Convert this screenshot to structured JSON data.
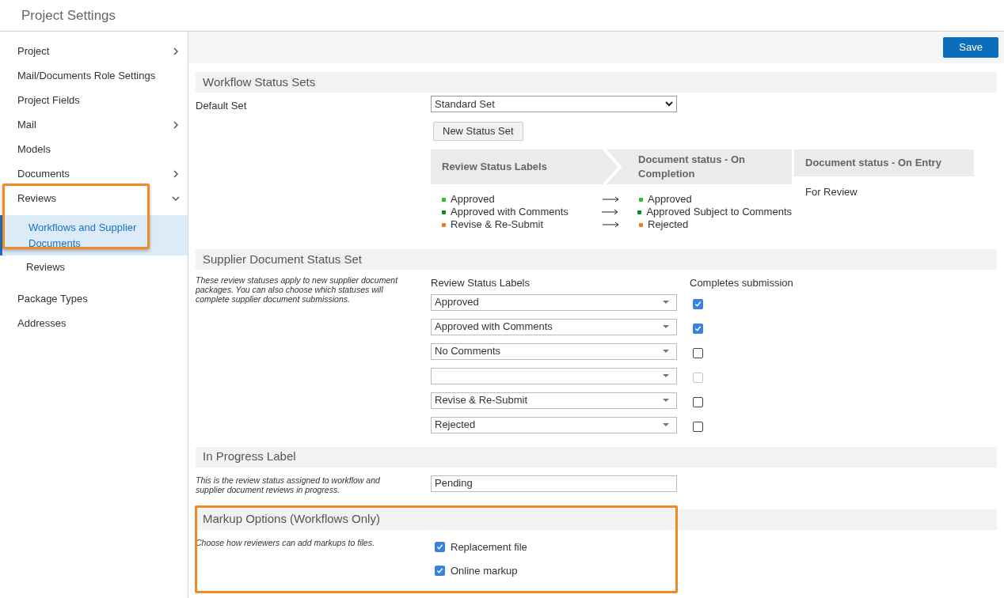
{
  "page": {
    "title": "Project Settings"
  },
  "sidebar": {
    "items": [
      {
        "label": "Project",
        "expanded": false
      },
      {
        "label": "Mail/Documents Role Settings"
      },
      {
        "label": "Project Fields"
      },
      {
        "label": "Mail",
        "expanded": false
      },
      {
        "label": "Models"
      },
      {
        "label": "Documents",
        "expanded": false
      },
      {
        "label": "Reviews",
        "expanded": true,
        "highlighted": true,
        "children": [
          {
            "label": "Workflows and Supplier Documents",
            "selected": true
          },
          {
            "label": "Reviews",
            "selected": false
          }
        ]
      },
      {
        "label": "Package Types"
      },
      {
        "label": "Addresses"
      }
    ]
  },
  "toolbar": {
    "save_button": "Save"
  },
  "workflow_status_sets": {
    "title": "Workflow Status Sets",
    "default_set_label": "Default Set",
    "default_set_value": "Standard Set",
    "new_button": "New Status Set",
    "headers": [
      "Review Status Labels",
      "Document status - On Completion",
      "Document status - On Entry"
    ],
    "mappings": [
      {
        "review": {
          "label": "Approved",
          "color": "#22c32e"
        },
        "completion": {
          "label": "Approved",
          "color": "#22c32e"
        }
      },
      {
        "review": {
          "label": "Approved with Comments",
          "color": "#0a8a1a"
        },
        "completion": {
          "label": "Approved Subject to Comments",
          "color": "#0a8a1a"
        }
      },
      {
        "review": {
          "label": "Revise & Re-Submit",
          "color": "#f07d1a"
        },
        "completion": {
          "label": "Rejected",
          "color": "#f07d1a"
        }
      }
    ],
    "on_entry": "For Review"
  },
  "supplier_document_status_set": {
    "title": "Supplier Document Status Set",
    "description": "These review statuses apply to new supplier document packages. You can also choose which statuses will complete supplier document submissions.",
    "columns": [
      "Review Status Labels",
      "Completes submission"
    ],
    "rows": [
      {
        "value": "Approved",
        "checked": true,
        "disabled": false
      },
      {
        "value": "Approved with Comments",
        "checked": true,
        "disabled": false
      },
      {
        "value": "No Comments",
        "checked": false,
        "disabled": false
      },
      {
        "checked": false,
        "disabled": true
      },
      {
        "value": "Revise & Re-Submit",
        "checked": false,
        "disabled": false
      },
      {
        "value": "Rejected",
        "checked": false,
        "disabled": false
      }
    ]
  },
  "in_progress_label": {
    "title": "In Progress Label",
    "description": "This is the review status assigned to workflow and supplier document reviews in progress.",
    "value": "Pending"
  },
  "markup_options": {
    "title": "Markup Options (Workflows Only)",
    "highlighted": true,
    "description": "Choose how reviewers can add markups to files.",
    "options": [
      {
        "label": "Replacement file",
        "checked": true
      },
      {
        "label": "Online markup",
        "checked": true
      }
    ]
  }
}
